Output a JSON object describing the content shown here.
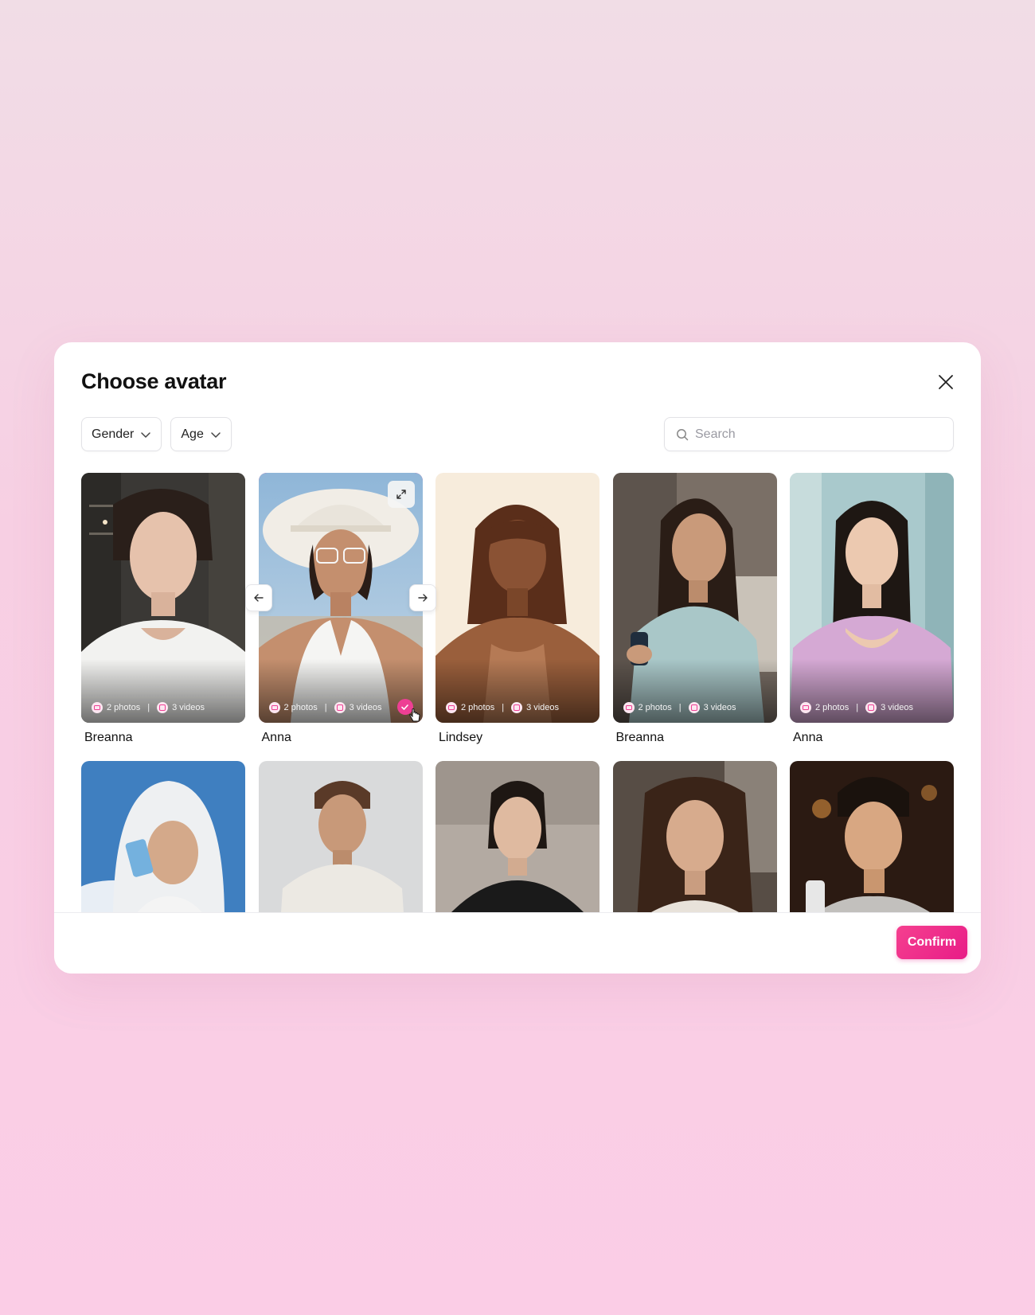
{
  "modal": {
    "title": "Choose avatar",
    "close_icon": "close-icon"
  },
  "filters": {
    "gender_label": "Gender",
    "age_label": "Age"
  },
  "search": {
    "placeholder": "Search",
    "value": ""
  },
  "avatars": [
    {
      "name": "Breanna",
      "photos": "2 photos",
      "videos": "3 videos",
      "selected": false
    },
    {
      "name": "Anna",
      "photos": "2 photos",
      "videos": "3 videos",
      "selected": true
    },
    {
      "name": "Lindsey",
      "photos": "2 photos",
      "videos": "3 videos",
      "selected": false
    },
    {
      "name": "Breanna",
      "photos": "2 photos",
      "videos": "3 videos",
      "selected": false
    },
    {
      "name": "Anna",
      "photos": "2 photos",
      "videos": "3 videos",
      "selected": false
    },
    {
      "name": "",
      "photos": "",
      "videos": "",
      "selected": false
    },
    {
      "name": "",
      "photos": "",
      "videos": "",
      "selected": false
    },
    {
      "name": "",
      "photos": "",
      "videos": "",
      "selected": false
    },
    {
      "name": "",
      "photos": "",
      "videos": "",
      "selected": false
    },
    {
      "name": "",
      "photos": "",
      "videos": "",
      "selected": false
    }
  ],
  "footer": {
    "confirm_label": "Confirm"
  },
  "colors": {
    "accent": "#ee3f94",
    "confirm_bg": "#e81c87",
    "background_top": "#f1dde6",
    "background_bottom": "#fbcde6"
  }
}
